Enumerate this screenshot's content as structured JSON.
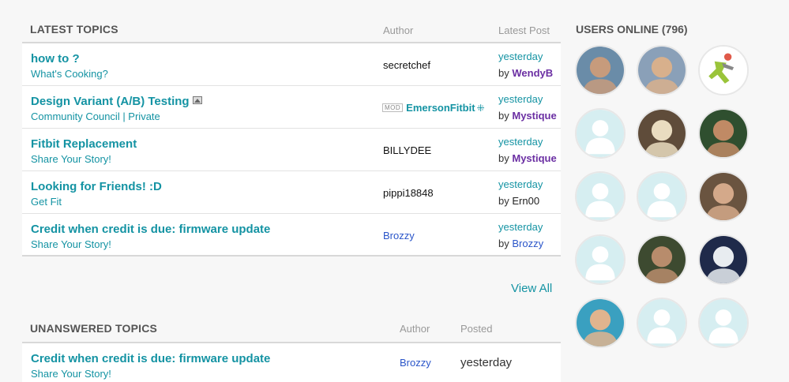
{
  "latest": {
    "title": "LATEST TOPICS",
    "author_header": "Author",
    "latest_header": "Latest Post",
    "rows": [
      {
        "title": "how to ?",
        "board": "What's Cooking?",
        "author": "secretchef",
        "when": "yesterday",
        "by": "by",
        "last_user": "WendyB"
      },
      {
        "title": "Design Variant (A/B) Testing",
        "board": "Community Council | Private",
        "mod_tag": "MOD",
        "author": "EmersonFitbit",
        "when": "yesterday",
        "by": "by",
        "last_user": "Mystique"
      },
      {
        "title": "Fitbit Replacement",
        "board": "Share Your Story!",
        "author": "BILLYDEE",
        "when": "yesterday",
        "by": "by",
        "last_user": "Mystique"
      },
      {
        "title": "Looking for Friends! :D",
        "board": "Get Fit",
        "author": "pippi18848",
        "when": "yesterday",
        "by": "by",
        "last_user": "Ern00"
      },
      {
        "title": "Credit when credit is due: firmware update",
        "board": "Share Your Story!",
        "author": "Brozzy",
        "when": "yesterday",
        "by": "by",
        "last_user": "Brozzy"
      }
    ],
    "view_all": "View All"
  },
  "unanswered": {
    "title": "UNANSWERED TOPICS",
    "author_header": "Author",
    "posted_header": "Posted",
    "rows": [
      {
        "title": "Credit when credit is due: firmware update",
        "board": "Share Your Story!",
        "author": "Brozzy",
        "posted": "yesterday"
      }
    ]
  },
  "users_online": {
    "title": "USERS ONLINE (796)",
    "avatars": [
      {
        "kind": "photo",
        "name": "user-avatar-1",
        "colors": [
          "#6a8ca8",
          "#c79b7c"
        ]
      },
      {
        "kind": "photo",
        "name": "user-avatar-2",
        "colors": [
          "#8aa0b8",
          "#d8b08c"
        ]
      },
      {
        "kind": "logo",
        "name": "user-avatar-3",
        "colors": [
          "#9ac43a",
          "#e05a4a"
        ]
      },
      {
        "kind": "default",
        "name": "user-avatar-4"
      },
      {
        "kind": "photo",
        "name": "user-avatar-5",
        "colors": [
          "#5f4c3a",
          "#e9dcc0"
        ]
      },
      {
        "kind": "photo",
        "name": "user-avatar-6",
        "colors": [
          "#2f4f2f",
          "#c08a65"
        ]
      },
      {
        "kind": "default",
        "name": "user-avatar-7"
      },
      {
        "kind": "default",
        "name": "user-avatar-8"
      },
      {
        "kind": "photo",
        "name": "user-avatar-9",
        "colors": [
          "#6a5440",
          "#d4a98a"
        ]
      },
      {
        "kind": "default",
        "name": "user-avatar-10"
      },
      {
        "kind": "photo",
        "name": "user-avatar-11",
        "colors": [
          "#3d4a30",
          "#b88c6c"
        ]
      },
      {
        "kind": "photo",
        "name": "user-avatar-12",
        "colors": [
          "#1f2a4a",
          "#e8ecf0"
        ]
      },
      {
        "kind": "photo",
        "name": "user-avatar-13",
        "colors": [
          "#3aa0c0",
          "#e0b48e"
        ]
      },
      {
        "kind": "default",
        "name": "user-avatar-14"
      },
      {
        "kind": "default",
        "name": "user-avatar-15"
      }
    ]
  }
}
